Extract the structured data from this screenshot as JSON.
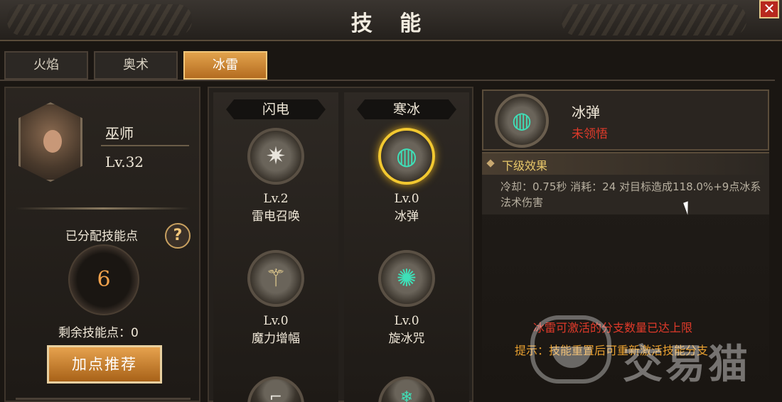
{
  "window": {
    "title": "技 能",
    "close_label": "✕"
  },
  "tabs": [
    {
      "label": "火焰",
      "active": false
    },
    {
      "label": "奥术",
      "active": false
    },
    {
      "label": "冰雷",
      "active": true
    }
  ],
  "hero": {
    "name": "巫师",
    "level": "Lv.32"
  },
  "points": {
    "allocated_label": "已分配技能点",
    "allocated_value": "6",
    "remaining_label": "剩余技能点：0",
    "help_icon": "?",
    "recommend_button": "加点推荐"
  },
  "tree": {
    "columns": [
      {
        "header": "闪电",
        "skills": [
          {
            "level": "Lv.2",
            "name": "雷电召唤",
            "icon": "lightning-burst-icon"
          },
          {
            "level": "Lv.0",
            "name": "魔力增幅",
            "icon": "staff-icon"
          },
          {
            "level": "",
            "name": "",
            "icon": "partial-skill-icon"
          }
        ]
      },
      {
        "header": "寒冰",
        "skills": [
          {
            "level": "Lv.0",
            "name": "冰弹",
            "icon": "ice-orb-icon",
            "selected": true
          },
          {
            "level": "Lv.0",
            "name": "旋冰咒",
            "icon": "ice-spiral-icon"
          },
          {
            "level": "",
            "name": "",
            "icon": "partial-skill-icon"
          }
        ]
      }
    ]
  },
  "detail": {
    "name": "冰弹",
    "status": "未领悟",
    "effect_title": "下级效果",
    "effect_text": "冷却：0.75秒  消耗：24  对目标造成118.0%+9点冰系法术伤害",
    "warning_line": "冰雷可激活的分支数量已达上限",
    "tip_line": "提示：技能重置后可重新激活技能分支"
  },
  "watermark": {
    "text": "交易猫"
  },
  "colors": {
    "accent": "#e2a24c",
    "selected_ring": "#f2c830",
    "status_red": "#e03a2a",
    "effect_gold": "#e8c86a"
  }
}
